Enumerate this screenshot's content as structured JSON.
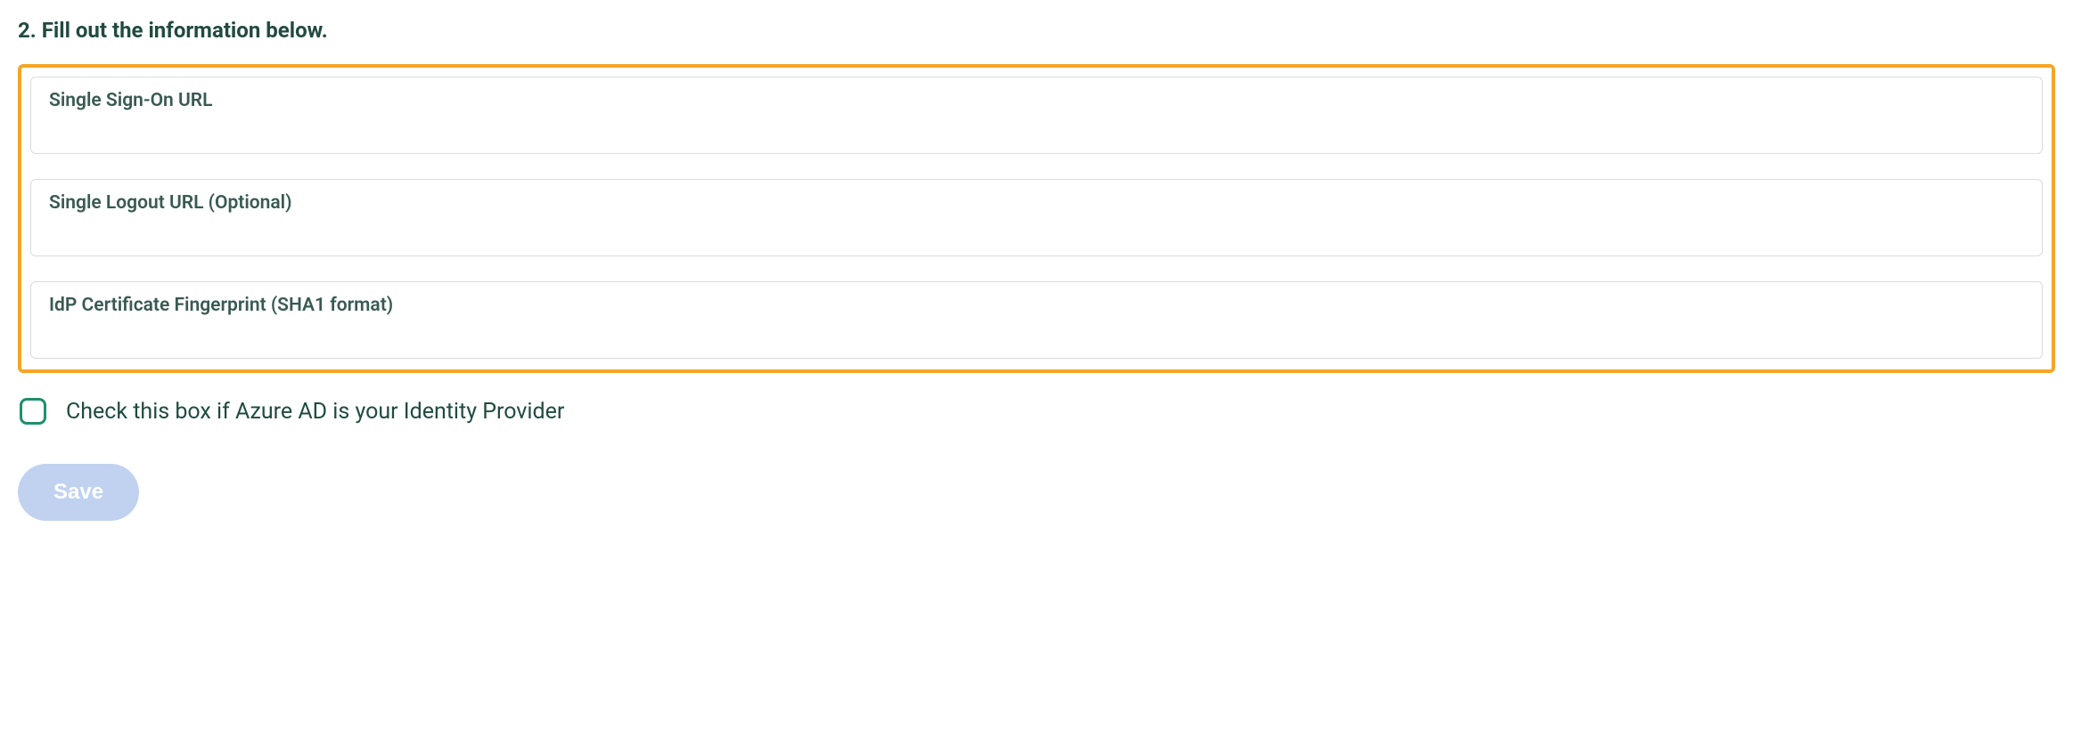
{
  "heading": "2. Fill out the information below.",
  "fields": {
    "sso_url": {
      "label": "Single Sign-On URL",
      "value": ""
    },
    "logout_url": {
      "label": "Single Logout URL (Optional)",
      "value": ""
    },
    "fingerprint": {
      "label": "IdP Certificate Fingerprint (SHA1 format)",
      "value": ""
    }
  },
  "checkbox": {
    "label": "Check this box if Azure AD is your Identity Provider",
    "checked": false
  },
  "save_label": "Save"
}
